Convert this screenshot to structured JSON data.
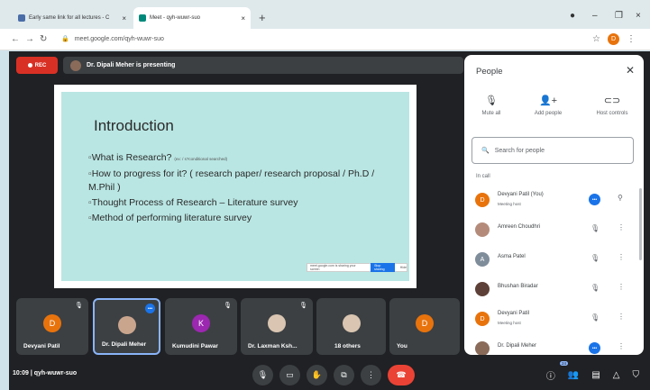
{
  "browser": {
    "tabs": [
      {
        "label": "Early same link for all lectures - C",
        "active": false
      },
      {
        "label": "Meet - qyh-wuwr-suo",
        "active": true
      }
    ],
    "url": "meet.google.com/qyh-wuwr-suo",
    "profile_initial": "D"
  },
  "meet": {
    "rec_label": "REC",
    "presenting_text": "Dr. Dipali Meher is presenting",
    "slide": {
      "title": "Introduction",
      "bullets": [
        {
          "text": "What is Research?",
          "small": "(ex: / s?conditional searched)"
        },
        {
          "text": "How to progress for it? ( research paper/ research proposal / Ph.D / M.Phil )",
          "small": ""
        },
        {
          "text": "Thought Process of Research – Literature survey",
          "small": ""
        },
        {
          "text": "Method of performing literature survey",
          "small": ""
        }
      ],
      "notice": "meet.google.com is sharing your screen",
      "notice_button": "Stop sharing",
      "notice_hide": "Hide"
    },
    "tiles": [
      {
        "name": "Devyani Patil",
        "initial": "D",
        "color": "#e8730c"
      },
      {
        "name": "Dr. Dipali Meher",
        "initial": "",
        "color": ""
      },
      {
        "name": "Kumudini Pawar",
        "initial": "K",
        "color": "#9c27b0"
      },
      {
        "name": "Dr. Laxman Ksh...",
        "initial": "",
        "color": ""
      },
      {
        "name": "18 others",
        "initial": "",
        "color": ""
      },
      {
        "name": "You",
        "initial": "D",
        "color": "#e8730c"
      }
    ],
    "time": "10:09",
    "meeting_code": "qyh-wuwr-suo",
    "participants_count": "24"
  },
  "people_panel": {
    "title": "People",
    "actions": [
      {
        "label": "Mute all",
        "icon": "mic-off-icon"
      },
      {
        "label": "Add people",
        "icon": "add-person-icon"
      },
      {
        "label": "Host controls",
        "icon": "toggle-icon"
      }
    ],
    "search_placeholder": "Search for people",
    "section": "In call",
    "participants": [
      {
        "name": "Devyani Patil (You)",
        "sub": "Meeting host",
        "initial": "D",
        "color": "#e8730c",
        "speaking": true
      },
      {
        "name": "Amreen Choudhri",
        "sub": "",
        "initial": "",
        "color": "#b48b7a",
        "speaking": false
      },
      {
        "name": "Asma Patel",
        "sub": "",
        "initial": "A",
        "color": "#7f8c9a",
        "speaking": false
      },
      {
        "name": "Bhushan Biradar",
        "sub": "",
        "initial": "",
        "color": "#5d4037",
        "speaking": false
      },
      {
        "name": "Devyani Patil",
        "sub": "Meeting host",
        "initial": "D",
        "color": "#e8730c",
        "speaking": false
      },
      {
        "name": "Dr. Dipali Meher",
        "sub": "",
        "initial": "",
        "color": "#8a6b5a",
        "speaking": true
      }
    ]
  }
}
